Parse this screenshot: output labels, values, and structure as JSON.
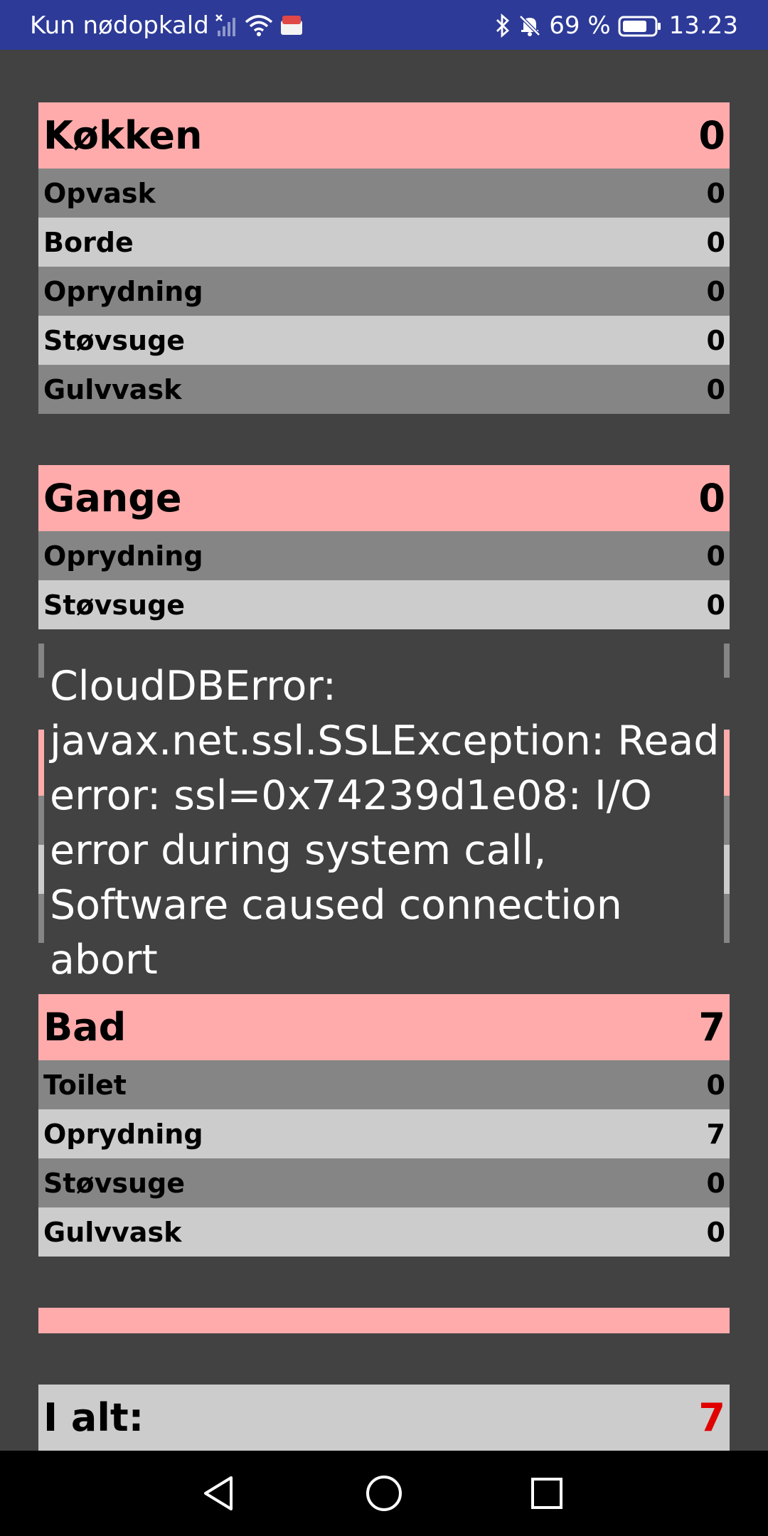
{
  "status_bar": {
    "carrier": "Kun nødopkald",
    "battery": "69 %",
    "time": "13.23"
  },
  "sections": [
    {
      "title": "Køkken",
      "total": "0",
      "rows": [
        {
          "label": "Opvask",
          "value": "0"
        },
        {
          "label": "Borde",
          "value": "0"
        },
        {
          "label": "Oprydning",
          "value": "0"
        },
        {
          "label": "Støvsuge",
          "value": "0"
        },
        {
          "label": "Gulvvask",
          "value": "0"
        }
      ]
    },
    {
      "title": "Gange",
      "total": "0",
      "rows": [
        {
          "label": "Oprydning",
          "value": "0"
        },
        {
          "label": "Støvsuge",
          "value": "0"
        }
      ]
    },
    {
      "title": "Bad",
      "total": "7",
      "rows": [
        {
          "label": "Toilet",
          "value": "0"
        },
        {
          "label": "Oprydning",
          "value": "7"
        },
        {
          "label": "Støvsuge",
          "value": "0"
        },
        {
          "label": "Gulvvask",
          "value": "0"
        }
      ]
    }
  ],
  "error_toast": "CloudDBError: javax.net.ssl.SSLException: Read error: ssl=0x74239d1e08: I/O error during system call, Software caused connection abort",
  "grand_total": {
    "label": "I alt:",
    "value": "7"
  },
  "colors": {
    "status_bar": "#2d3a97",
    "background": "#424242",
    "section_header": "#ffabab",
    "row_dark": "#858585",
    "row_light": "#cccccc",
    "total_value": "#e00000"
  }
}
